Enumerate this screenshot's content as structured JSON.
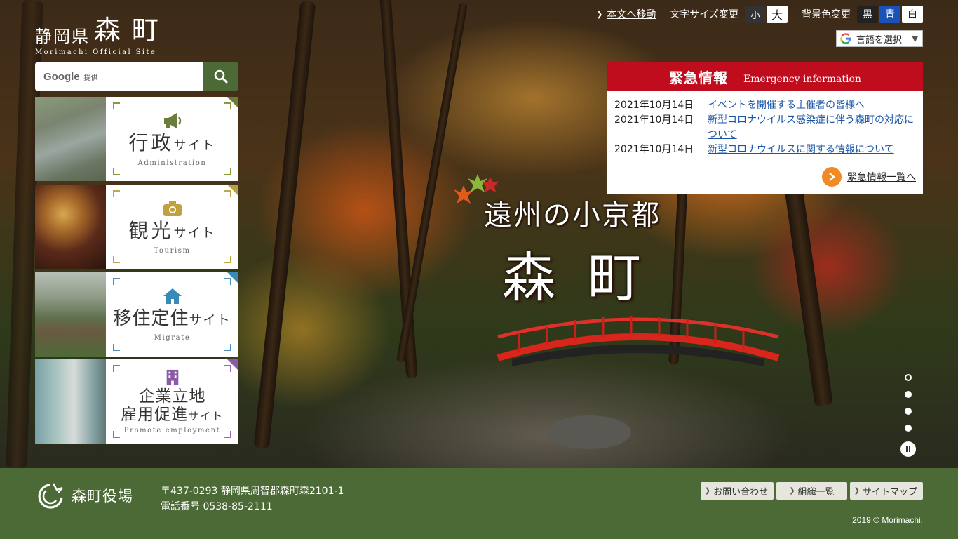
{
  "header": {
    "prefecture": "静岡県",
    "town": "森町",
    "subtitle": "Morimachi Official Site",
    "skip_link": "本文へ移動",
    "font_size_label": "文字サイズ変更",
    "font_size_small": "小",
    "font_size_large": "大",
    "bg_color_label": "背景色変更",
    "bg_black": "黒",
    "bg_blue": "青",
    "bg_white": "白",
    "translate_label": "言語を選択"
  },
  "search": {
    "brand": "Google",
    "provided": "提供"
  },
  "tiles": [
    {
      "name": "行政",
      "suffix": "サイト",
      "en": "Administration",
      "accent": "#6b7d3a",
      "icon": "megaphone-icon"
    },
    {
      "name": "観光",
      "suffix": "サイト",
      "en": "Tourism",
      "accent": "#b9a040",
      "icon": "camera-icon"
    },
    {
      "name": "移住定住",
      "suffix": "サイト",
      "en": "Migrate",
      "accent": "#3a8ab8",
      "icon": "house-icon"
    },
    {
      "name_line1": "企業立地",
      "name_line2": "雇用促進",
      "suffix": "サイト",
      "en": "Promote employment",
      "accent": "#8b5aa8",
      "icon": "building-icon"
    }
  ],
  "hero": {
    "catch": "遠州の小京都",
    "title": "森町"
  },
  "emergency": {
    "title": "緊急情報",
    "title_en": "Emergency information",
    "items": [
      {
        "date": "2021年10月14日",
        "text": "イベントを開催する主催者の皆様へ"
      },
      {
        "date": "2021年10月14日",
        "text": "新型コロナウイルス感染症に伴う森町の対応について"
      },
      {
        "date": "2021年10月14日",
        "text": "新型コロナウイルスに関する情報について"
      }
    ],
    "more": "緊急情報一覧へ"
  },
  "footer": {
    "office": "森町役場",
    "address": "〒437-0293 静岡県周智郡森町森2101-1",
    "phone": "電話番号 0538-85-2111",
    "contact": "お問い合わせ",
    "org": "組織一覧",
    "sitemap": "サイトマップ",
    "copyright": "2019 © Morimachi."
  },
  "colors": {
    "footer_green": "#4b6a35",
    "emergency_red": "#c00d1e",
    "link_blue": "#1a55a8",
    "more_orange": "#f08a24"
  }
}
